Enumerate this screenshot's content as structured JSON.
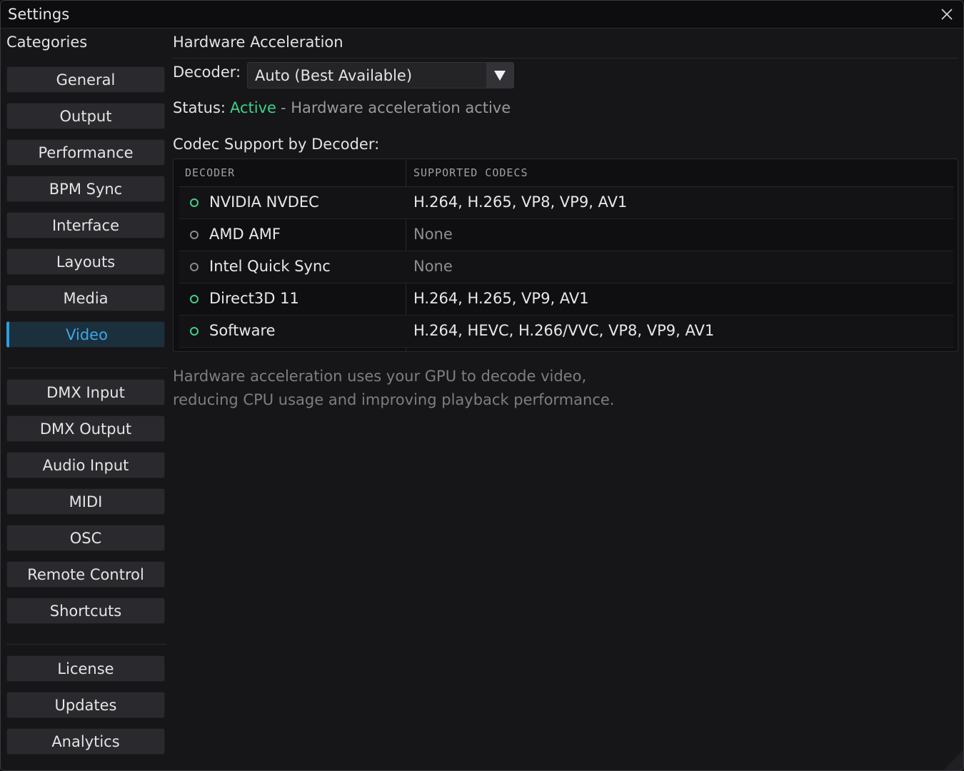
{
  "window": {
    "title": "Settings"
  },
  "sidebar": {
    "header": "Categories",
    "groups": [
      [
        "General",
        "Output",
        "Performance",
        "BPM Sync",
        "Interface",
        "Layouts",
        "Media",
        "Video"
      ],
      [
        "DMX Input",
        "DMX Output",
        "Audio Input",
        "MIDI",
        "OSC",
        "Remote Control",
        "Shortcuts"
      ],
      [
        "License",
        "Updates",
        "Analytics"
      ]
    ],
    "active": "Video"
  },
  "main": {
    "section_title": "Hardware Acceleration",
    "decoder_label": "Decoder:",
    "decoder_value": "Auto (Best Available)",
    "status_label": "Status:",
    "status_value": "Active",
    "status_desc": "- Hardware acceleration active",
    "codec_title": "Codec Support by Decoder:",
    "table": {
      "headers": [
        "DECODER",
        "SUPPORTED CODECS"
      ],
      "rows": [
        {
          "decoder": "NVIDIA NVDEC",
          "codecs": "H.264, H.265, VP8, VP9, AV1",
          "available": true
        },
        {
          "decoder": "AMD AMF",
          "codecs": "None",
          "available": false
        },
        {
          "decoder": "Intel Quick Sync",
          "codecs": "None",
          "available": false
        },
        {
          "decoder": "Direct3D 11",
          "codecs": "H.264, H.265, VP9, AV1",
          "available": true
        },
        {
          "decoder": "Software",
          "codecs": "H.264, HEVC, H.266/VVC, VP8, VP9, AV1",
          "available": true
        }
      ]
    },
    "help_lines": [
      "Hardware acceleration uses your GPU to decode video,",
      "reducing CPU usage and improving playback performance."
    ]
  },
  "colors": {
    "accent": "#2c9de2",
    "active_status": "#3fd08a",
    "muted": "#7e7e82"
  },
  "icons": {
    "close": "close-icon",
    "dropdown": "triangle-down-icon",
    "status_dot": "status-dot-icon"
  }
}
